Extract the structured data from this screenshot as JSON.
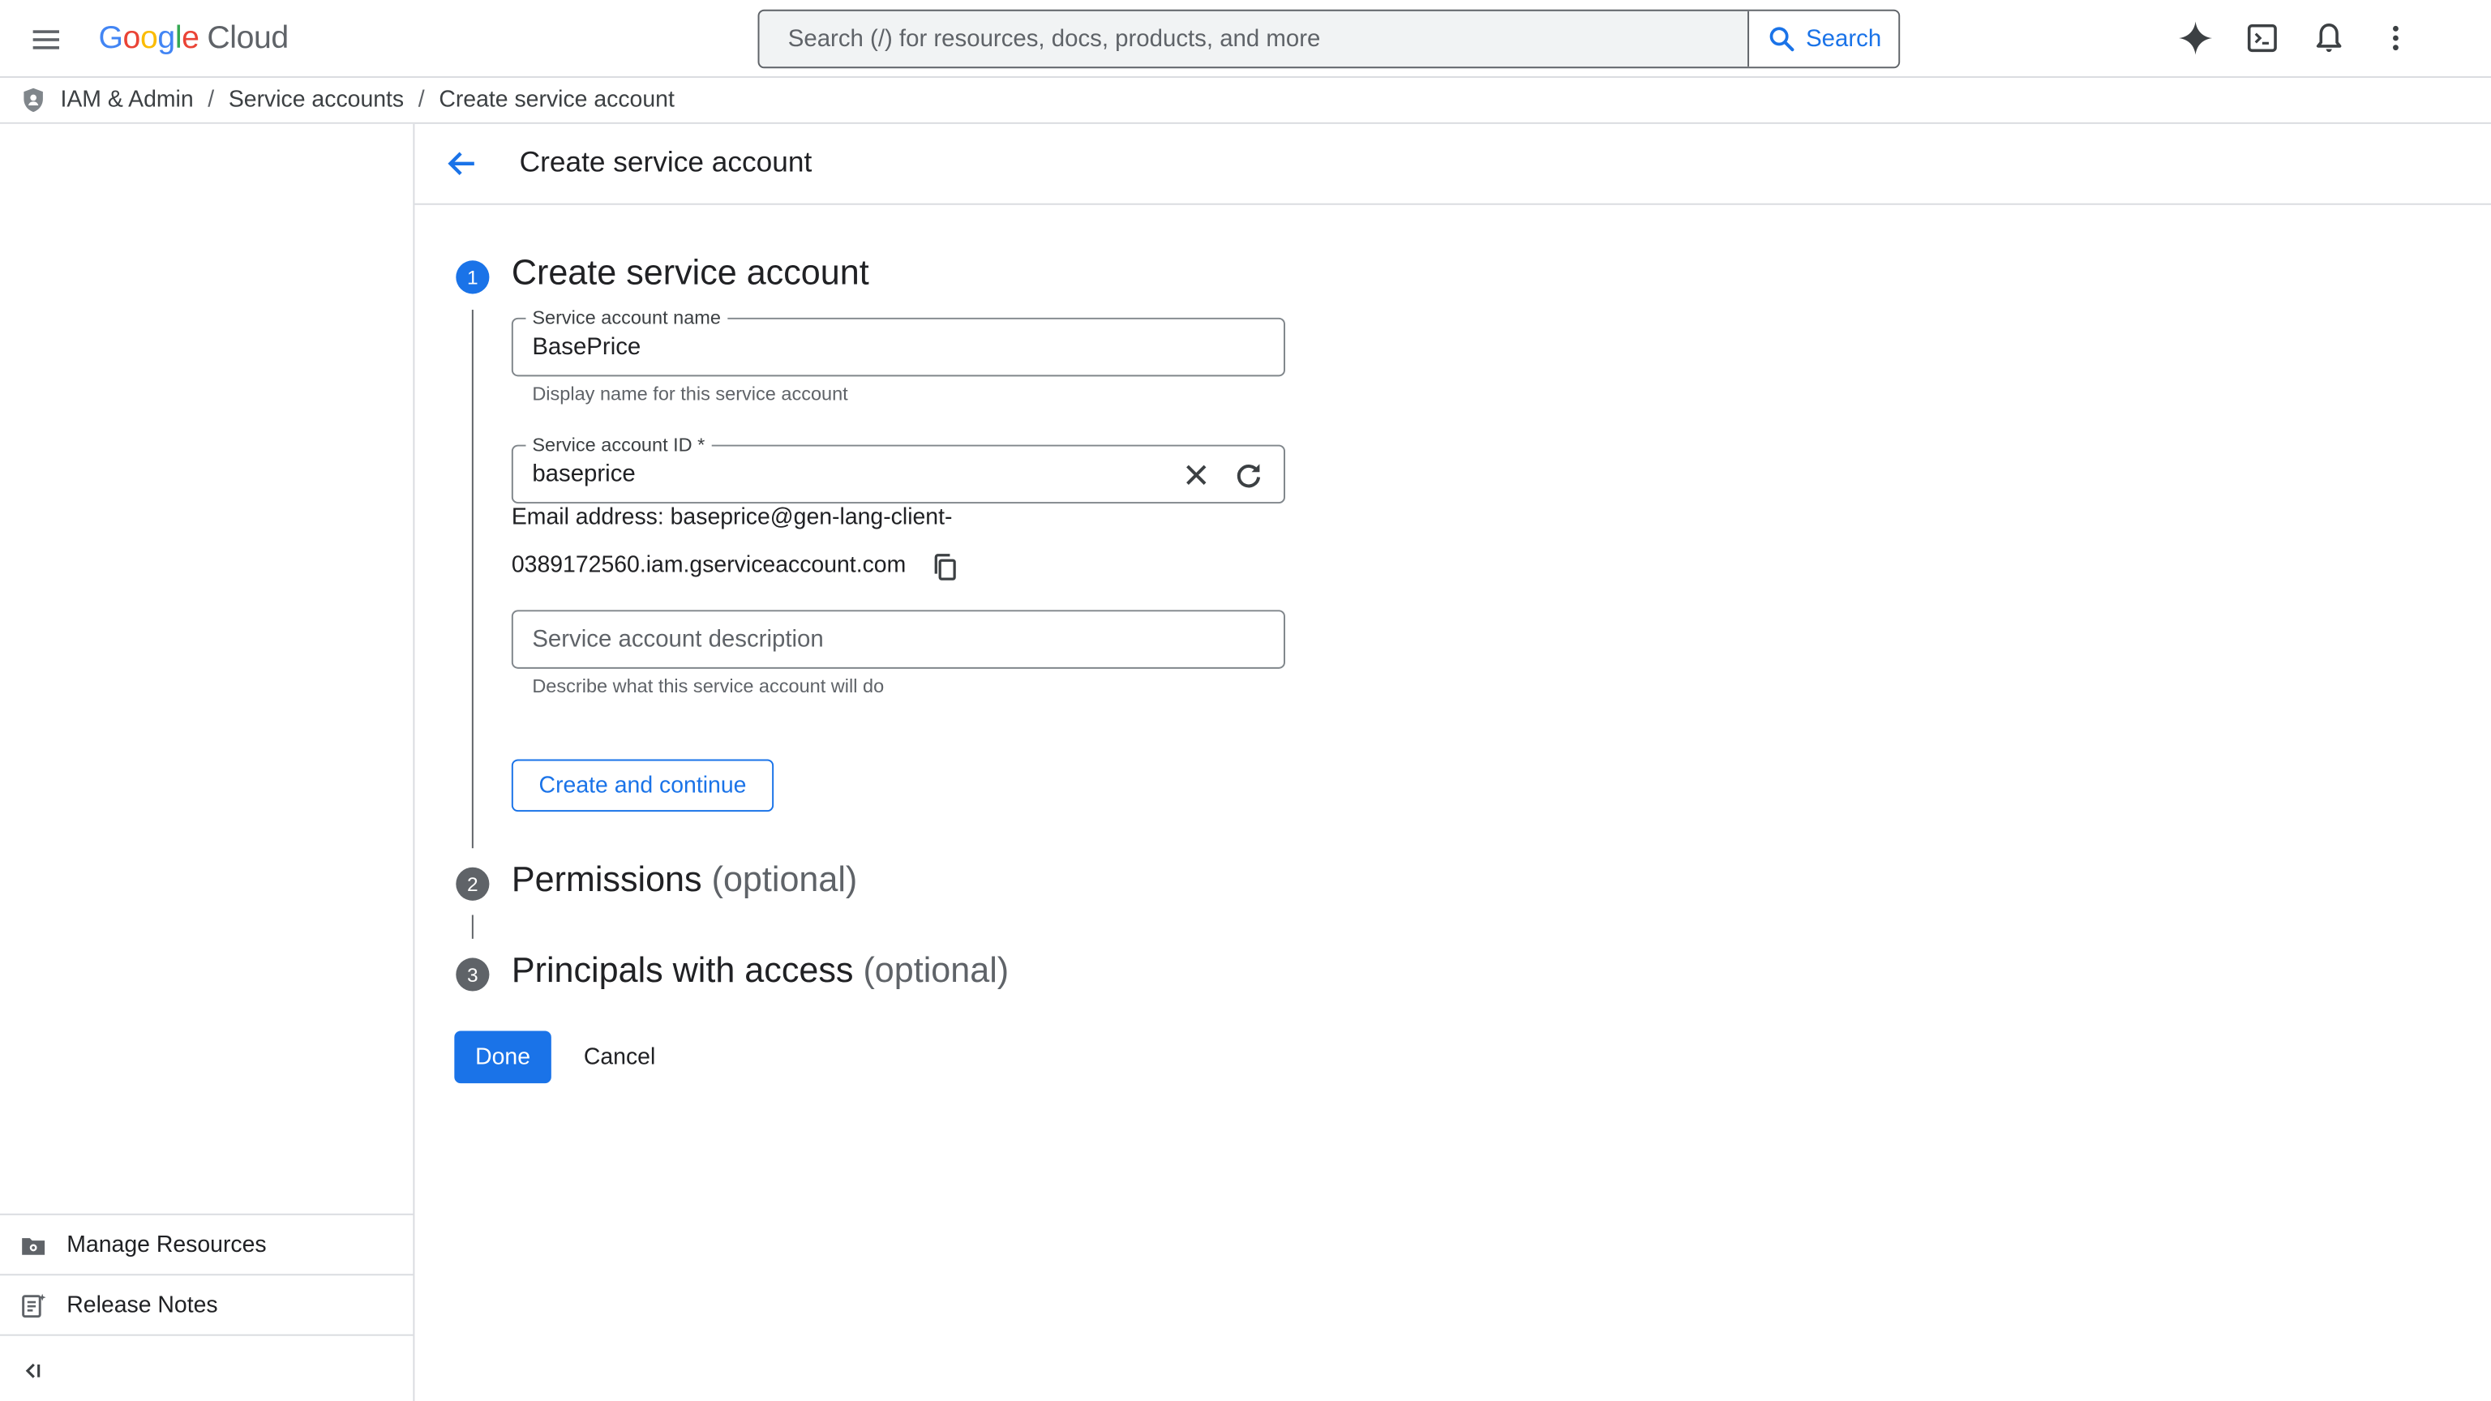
{
  "topbar": {
    "logo_google": [
      "G",
      "o",
      "o",
      "g",
      "l",
      "e"
    ],
    "logo_cloud": "Cloud",
    "search_placeholder": "Search (/) for resources, docs, products, and more",
    "search_button": "Search"
  },
  "breadcrumb": {
    "items": [
      "IAM & Admin",
      "Service accounts",
      "Create service account"
    ],
    "separator": "/"
  },
  "sidebar": {
    "items": [
      {
        "label": "Manage Resources",
        "icon": "manage-resources-icon"
      },
      {
        "label": "Release Notes",
        "icon": "release-notes-icon"
      }
    ]
  },
  "page": {
    "title": "Create service account"
  },
  "steps": [
    {
      "number": "1",
      "title": "Create service account",
      "optional": ""
    },
    {
      "number": "2",
      "title": "Permissions",
      "optional": "(optional)"
    },
    {
      "number": "3",
      "title": "Principals with access",
      "optional": "(optional)"
    }
  ],
  "form": {
    "name_label": "Service account name",
    "name_value": "BasePrice",
    "name_hint": "Display name for this service account",
    "id_label": "Service account ID *",
    "id_value": "baseprice",
    "email_line1": "Email address: baseprice@gen-lang-client-",
    "email_line2": "0389172560.iam.gserviceaccount.com",
    "description_placeholder": "Service account description",
    "description_hint": "Describe what this service account will do",
    "create_button": "Create and continue"
  },
  "actions": {
    "done": "Done",
    "cancel": "Cancel"
  },
  "colors": {
    "accent": "#1a73e8",
    "step_active": "#1a73e8",
    "step_inactive": "#5f6368"
  }
}
